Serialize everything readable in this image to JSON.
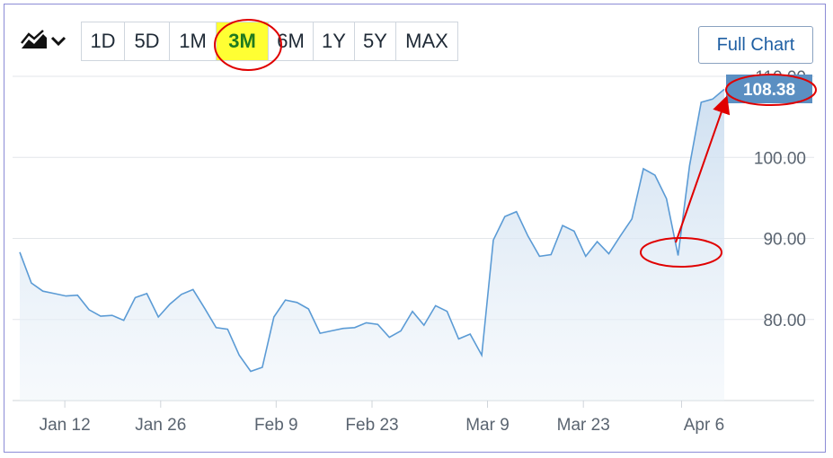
{
  "toolbar": {
    "chart_type_icon": "area-chart-icon",
    "ranges": [
      "1D",
      "5D",
      "1M",
      "3M",
      "6M",
      "1Y",
      "5Y",
      "MAX"
    ],
    "active_range": "3M",
    "full_chart_label": "Full Chart"
  },
  "colors": {
    "line": "#5b9bd5",
    "fill_top": "#c9dcef",
    "price_tag": "#5b8fc2",
    "annotation": "#e00000",
    "active_range_bg": "#ffff33"
  },
  "chart_data": {
    "type": "area",
    "title": "",
    "xlabel": "",
    "ylabel": "",
    "x_ticks": [
      "Jan 12",
      "Jan 26",
      "Feb 9",
      "Feb 23",
      "Mar 9",
      "Mar 23",
      "Apr 6"
    ],
    "y_ticks": [
      "80.00",
      "90.00",
      "100.00",
      "110.00"
    ],
    "ylim": [
      70,
      110
    ],
    "grid": true,
    "last_price": "108.38",
    "series": [
      {
        "values": [
          88.3,
          84.5,
          83.5,
          83.2,
          82.9,
          83.0,
          81.2,
          80.4,
          80.5,
          79.9,
          82.7,
          83.2,
          80.3,
          81.9,
          83.1,
          83.7,
          81.4,
          79.0,
          78.8,
          75.6,
          73.6,
          74.1,
          80.3,
          82.4,
          82.1,
          81.3,
          78.3,
          78.6,
          78.9,
          79.0,
          79.6,
          79.4,
          77.8,
          78.6,
          81.0,
          79.3,
          81.7,
          81.0,
          77.6,
          78.2,
          75.6,
          89.8,
          92.7,
          93.3,
          90.3,
          87.8,
          88.0,
          91.6,
          90.9,
          87.8,
          89.6,
          88.1,
          90.3,
          92.4,
          98.6,
          97.8,
          94.9,
          87.9,
          99.0,
          106.8,
          107.2,
          108.4
        ]
      }
    ],
    "annotations": [
      "3M range circled",
      "108.38 price circled",
      "Dip near Mar 30 circled with arrow to last price"
    ]
  }
}
